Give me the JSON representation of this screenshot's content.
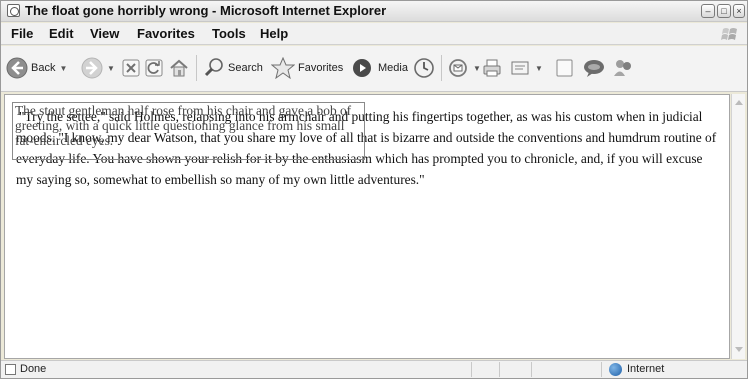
{
  "window": {
    "title": "The float gone horribly wrong - Microsoft Internet Explorer",
    "controls": {
      "minimize": "–",
      "maximize": "□",
      "close": "×"
    }
  },
  "menu": {
    "items": [
      "File",
      "Edit",
      "View",
      "Favorites",
      "Tools",
      "Help"
    ]
  },
  "toolbar": {
    "back_label": "Back",
    "search_label": "Search",
    "favorites_label": "Favorites",
    "media_label": "Media",
    "icons": [
      "back-arrow",
      "forward-arrow",
      "stop",
      "refresh",
      "home",
      "search",
      "favorites-star",
      "media",
      "history",
      "mail",
      "print",
      "edit",
      "discuss",
      "messenger"
    ]
  },
  "content": {
    "float_text": "The stout gentleman half rose from his chair and gave a bob of greeting, with a quick little questioning glance from his small fat-encircled eyes.",
    "paragraph": "\"Try the settee,\" said Holmes, relapsing into his armchair and putting his fingertips together, as was his custom when in judicial moods. \"I know, my dear Watson, that you share my love of all that is bizarre and outside the conventions and humdrum routine of everyday life. You have shown your relish for it by the enthusiasm which has prompted you to chronicle, and, if you will excuse my saying so, somewhat to embellish so many of my own little adventures.\""
  },
  "status": {
    "text": "Done",
    "zone": "Internet"
  }
}
